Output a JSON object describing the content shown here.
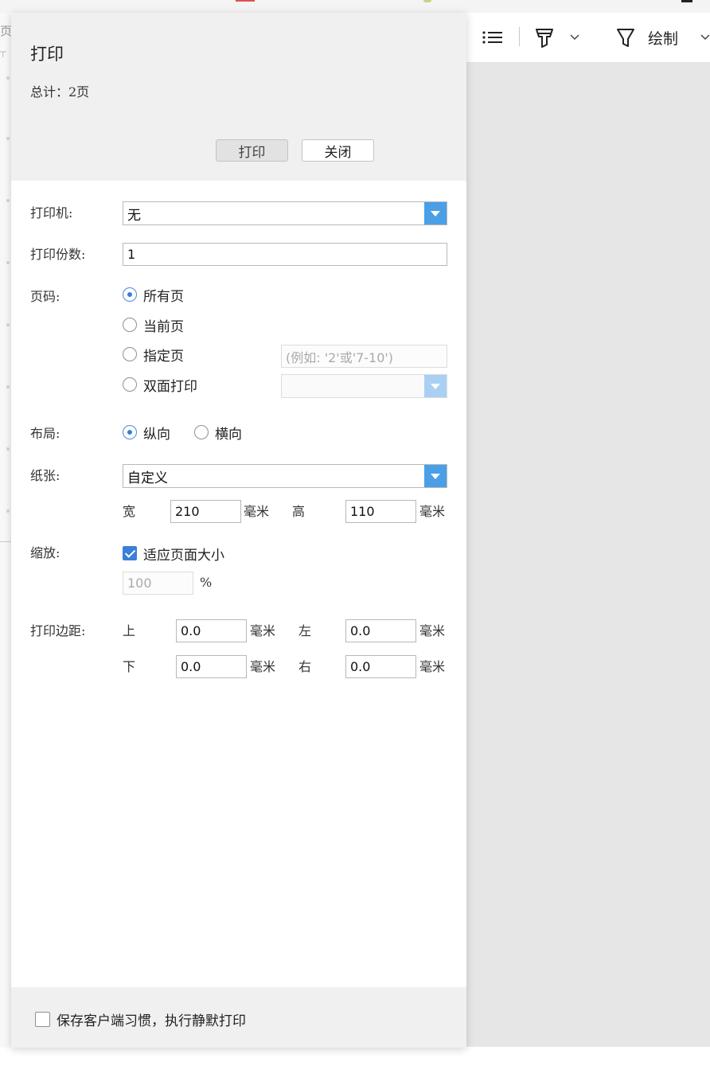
{
  "left_edge": {
    "text": "页"
  },
  "toolbar": {
    "list_icon": "list-icon",
    "highlighter_icon": "highlighter-icon",
    "draw_icon": "pen-icon",
    "draw_label": "绘制"
  },
  "dialog": {
    "title": "打印",
    "total": "总计：2页",
    "print_button": "打印",
    "close_button": "关闭",
    "printer": {
      "label": "打印机:",
      "value": "无"
    },
    "copies": {
      "label": "打印份数:",
      "value": "1"
    },
    "pages": {
      "label": "页码:",
      "options": [
        "所有页",
        "当前页",
        "指定页",
        "双面打印"
      ],
      "selected": "所有页",
      "range_placeholder": "(例如: '2'或'7-10')",
      "duplex_value": ""
    },
    "layout": {
      "label": "布局:",
      "options": [
        "纵向",
        "横向"
      ],
      "selected": "纵向"
    },
    "paper": {
      "label": "纸张:",
      "value": "自定义",
      "width_label": "宽",
      "width_value": "210",
      "height_label": "高",
      "height_value": "110",
      "unit": "毫米"
    },
    "scale": {
      "label": "缩放:",
      "fit_label": "适应页面大小",
      "fit_checked": true,
      "percent_value": "100",
      "percent_sign": "%"
    },
    "margins": {
      "label": "打印边距:",
      "top_label": "上",
      "top_value": "0.0",
      "left_label": "左",
      "left_value": "0.0",
      "bottom_label": "下",
      "bottom_value": "0.0",
      "right_label": "右",
      "right_value": "0.0",
      "unit": "毫米"
    },
    "footer": {
      "silent_print_label": "保存客户端习惯，执行静默打印",
      "checked": false
    }
  },
  "colors": {
    "accent": "#4a9fe6",
    "header_bg": "#f0f0f0",
    "preview_bg": "#e6e6e6"
  }
}
